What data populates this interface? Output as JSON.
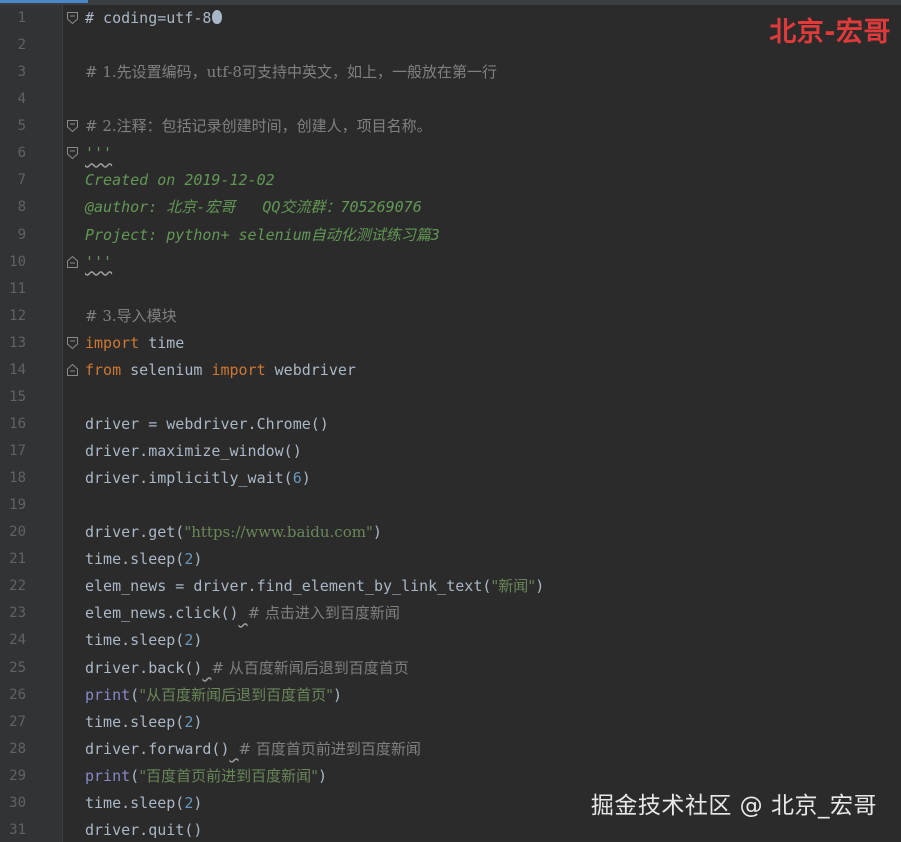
{
  "editor": {
    "colors": {
      "background": "#2b2b2b",
      "gutter": "#313335",
      "line_number": "#606366",
      "plain": "#a9b7c6",
      "comment": "#808080",
      "docstring": "#629755",
      "keyword": "#cc7832",
      "number": "#6897bb",
      "string": "#6a8759",
      "builtin": "#8888c6"
    },
    "lines": [
      {
        "n": "1",
        "fold": "open",
        "tokens": [
          {
            "t": "# coding=utf-8",
            "c": "plain"
          }
        ],
        "cursor_icon": true
      },
      {
        "n": "2",
        "tokens": []
      },
      {
        "n": "3",
        "tokens": [
          {
            "t": "# 1.先设置编码，utf-8可支持中英文，如上，一般放在第一行",
            "c": "comment"
          }
        ]
      },
      {
        "n": "4",
        "tokens": []
      },
      {
        "n": "5",
        "fold": "open",
        "tokens": [
          {
            "t": "# 2.注释：包括记录创建时间，创建人，项目名称。",
            "c": "comment"
          }
        ]
      },
      {
        "n": "6",
        "fold": "open",
        "tokens": [
          {
            "t": "'''",
            "c": "doc",
            "squiggle": true
          }
        ]
      },
      {
        "n": "7",
        "tokens": [
          {
            "t": "Created on 2019-12-02",
            "c": "doc"
          }
        ]
      },
      {
        "n": "8",
        "tokens": [
          {
            "t": "@author: 北京-宏哥   QQ交流群：705269076",
            "c": "doc"
          }
        ]
      },
      {
        "n": "9",
        "tokens": [
          {
            "t": "Project: python+ selenium自动化测试练习篇3",
            "c": "doc"
          }
        ]
      },
      {
        "n": "10",
        "fold": "close",
        "tokens": [
          {
            "t": "'''",
            "c": "doc",
            "squiggle": true
          }
        ]
      },
      {
        "n": "11",
        "tokens": []
      },
      {
        "n": "12",
        "tokens": [
          {
            "t": "# 3.导入模块",
            "c": "comment"
          }
        ]
      },
      {
        "n": "13",
        "fold": "open",
        "tokens": [
          {
            "t": "import",
            "c": "kw"
          },
          {
            "t": " time",
            "c": "plain"
          }
        ]
      },
      {
        "n": "14",
        "fold": "close",
        "tokens": [
          {
            "t": "from",
            "c": "kw"
          },
          {
            "t": " selenium ",
            "c": "plain"
          },
          {
            "t": "import",
            "c": "kw"
          },
          {
            "t": " webdriver",
            "c": "plain"
          }
        ]
      },
      {
        "n": "15",
        "tokens": []
      },
      {
        "n": "16",
        "tokens": [
          {
            "t": "driver = webdriver.Chrome()",
            "c": "plain"
          }
        ]
      },
      {
        "n": "17",
        "tokens": [
          {
            "t": "driver.maximize_window()",
            "c": "plain"
          }
        ]
      },
      {
        "n": "18",
        "tokens": [
          {
            "t": "driver.implicitly_wait(",
            "c": "plain"
          },
          {
            "t": "6",
            "c": "num"
          },
          {
            "t": ")",
            "c": "plain"
          }
        ]
      },
      {
        "n": "19",
        "tokens": []
      },
      {
        "n": "20",
        "tokens": [
          {
            "t": "driver.get(",
            "c": "plain"
          },
          {
            "t": "\"https://www.baidu.com\"",
            "c": "str"
          },
          {
            "t": ")",
            "c": "plain"
          }
        ]
      },
      {
        "n": "21",
        "tokens": [
          {
            "t": "time.sleep(",
            "c": "plain"
          },
          {
            "t": "2",
            "c": "num"
          },
          {
            "t": ")",
            "c": "plain"
          }
        ]
      },
      {
        "n": "22",
        "tokens": [
          {
            "t": "elem_news = driver.find_element_by_link_text(",
            "c": "plain"
          },
          {
            "t": "\"新闻\"",
            "c": "str"
          },
          {
            "t": ")",
            "c": "plain"
          }
        ]
      },
      {
        "n": "23",
        "tokens": [
          {
            "t": "elem_news.click()",
            "c": "plain"
          },
          {
            "t": " ",
            "c": "plain",
            "squiggle": true
          },
          {
            "t": "# 点击进入到百度新闻",
            "c": "comment"
          }
        ]
      },
      {
        "n": "24",
        "tokens": [
          {
            "t": "time.sleep(",
            "c": "plain"
          },
          {
            "t": "2",
            "c": "num"
          },
          {
            "t": ")",
            "c": "plain"
          }
        ]
      },
      {
        "n": "25",
        "tokens": [
          {
            "t": "driver.back()",
            "c": "plain"
          },
          {
            "t": " ",
            "c": "plain",
            "squiggle": true
          },
          {
            "t": "# 从百度新闻后退到百度首页",
            "c": "comment"
          }
        ]
      },
      {
        "n": "26",
        "tokens": [
          {
            "t": "print",
            "c": "builtin"
          },
          {
            "t": "(",
            "c": "plain"
          },
          {
            "t": "\"从百度新闻后退到百度首页\"",
            "c": "str"
          },
          {
            "t": ")",
            "c": "plain"
          }
        ]
      },
      {
        "n": "27",
        "tokens": [
          {
            "t": "time.sleep(",
            "c": "plain"
          },
          {
            "t": "2",
            "c": "num"
          },
          {
            "t": ")",
            "c": "plain"
          }
        ]
      },
      {
        "n": "28",
        "tokens": [
          {
            "t": "driver.forward()",
            "c": "plain"
          },
          {
            "t": " ",
            "c": "plain",
            "squiggle": true
          },
          {
            "t": "# 百度首页前进到百度新闻",
            "c": "comment"
          }
        ]
      },
      {
        "n": "29",
        "tokens": [
          {
            "t": "print",
            "c": "builtin"
          },
          {
            "t": "(",
            "c": "plain"
          },
          {
            "t": "\"百度首页前进到百度新闻\"",
            "c": "str"
          },
          {
            "t": ")",
            "c": "plain"
          }
        ]
      },
      {
        "n": "30",
        "tokens": [
          {
            "t": "time.sleep(",
            "c": "plain"
          },
          {
            "t": "2",
            "c": "num"
          },
          {
            "t": ")",
            "c": "plain"
          }
        ]
      },
      {
        "n": "31",
        "tokens": [
          {
            "t": "driver.quit()",
            "c": "plain"
          }
        ]
      }
    ]
  },
  "watermarks": {
    "top_right": "北京-宏哥",
    "bottom_right": "掘金技术社区 @ 北京_宏哥"
  }
}
